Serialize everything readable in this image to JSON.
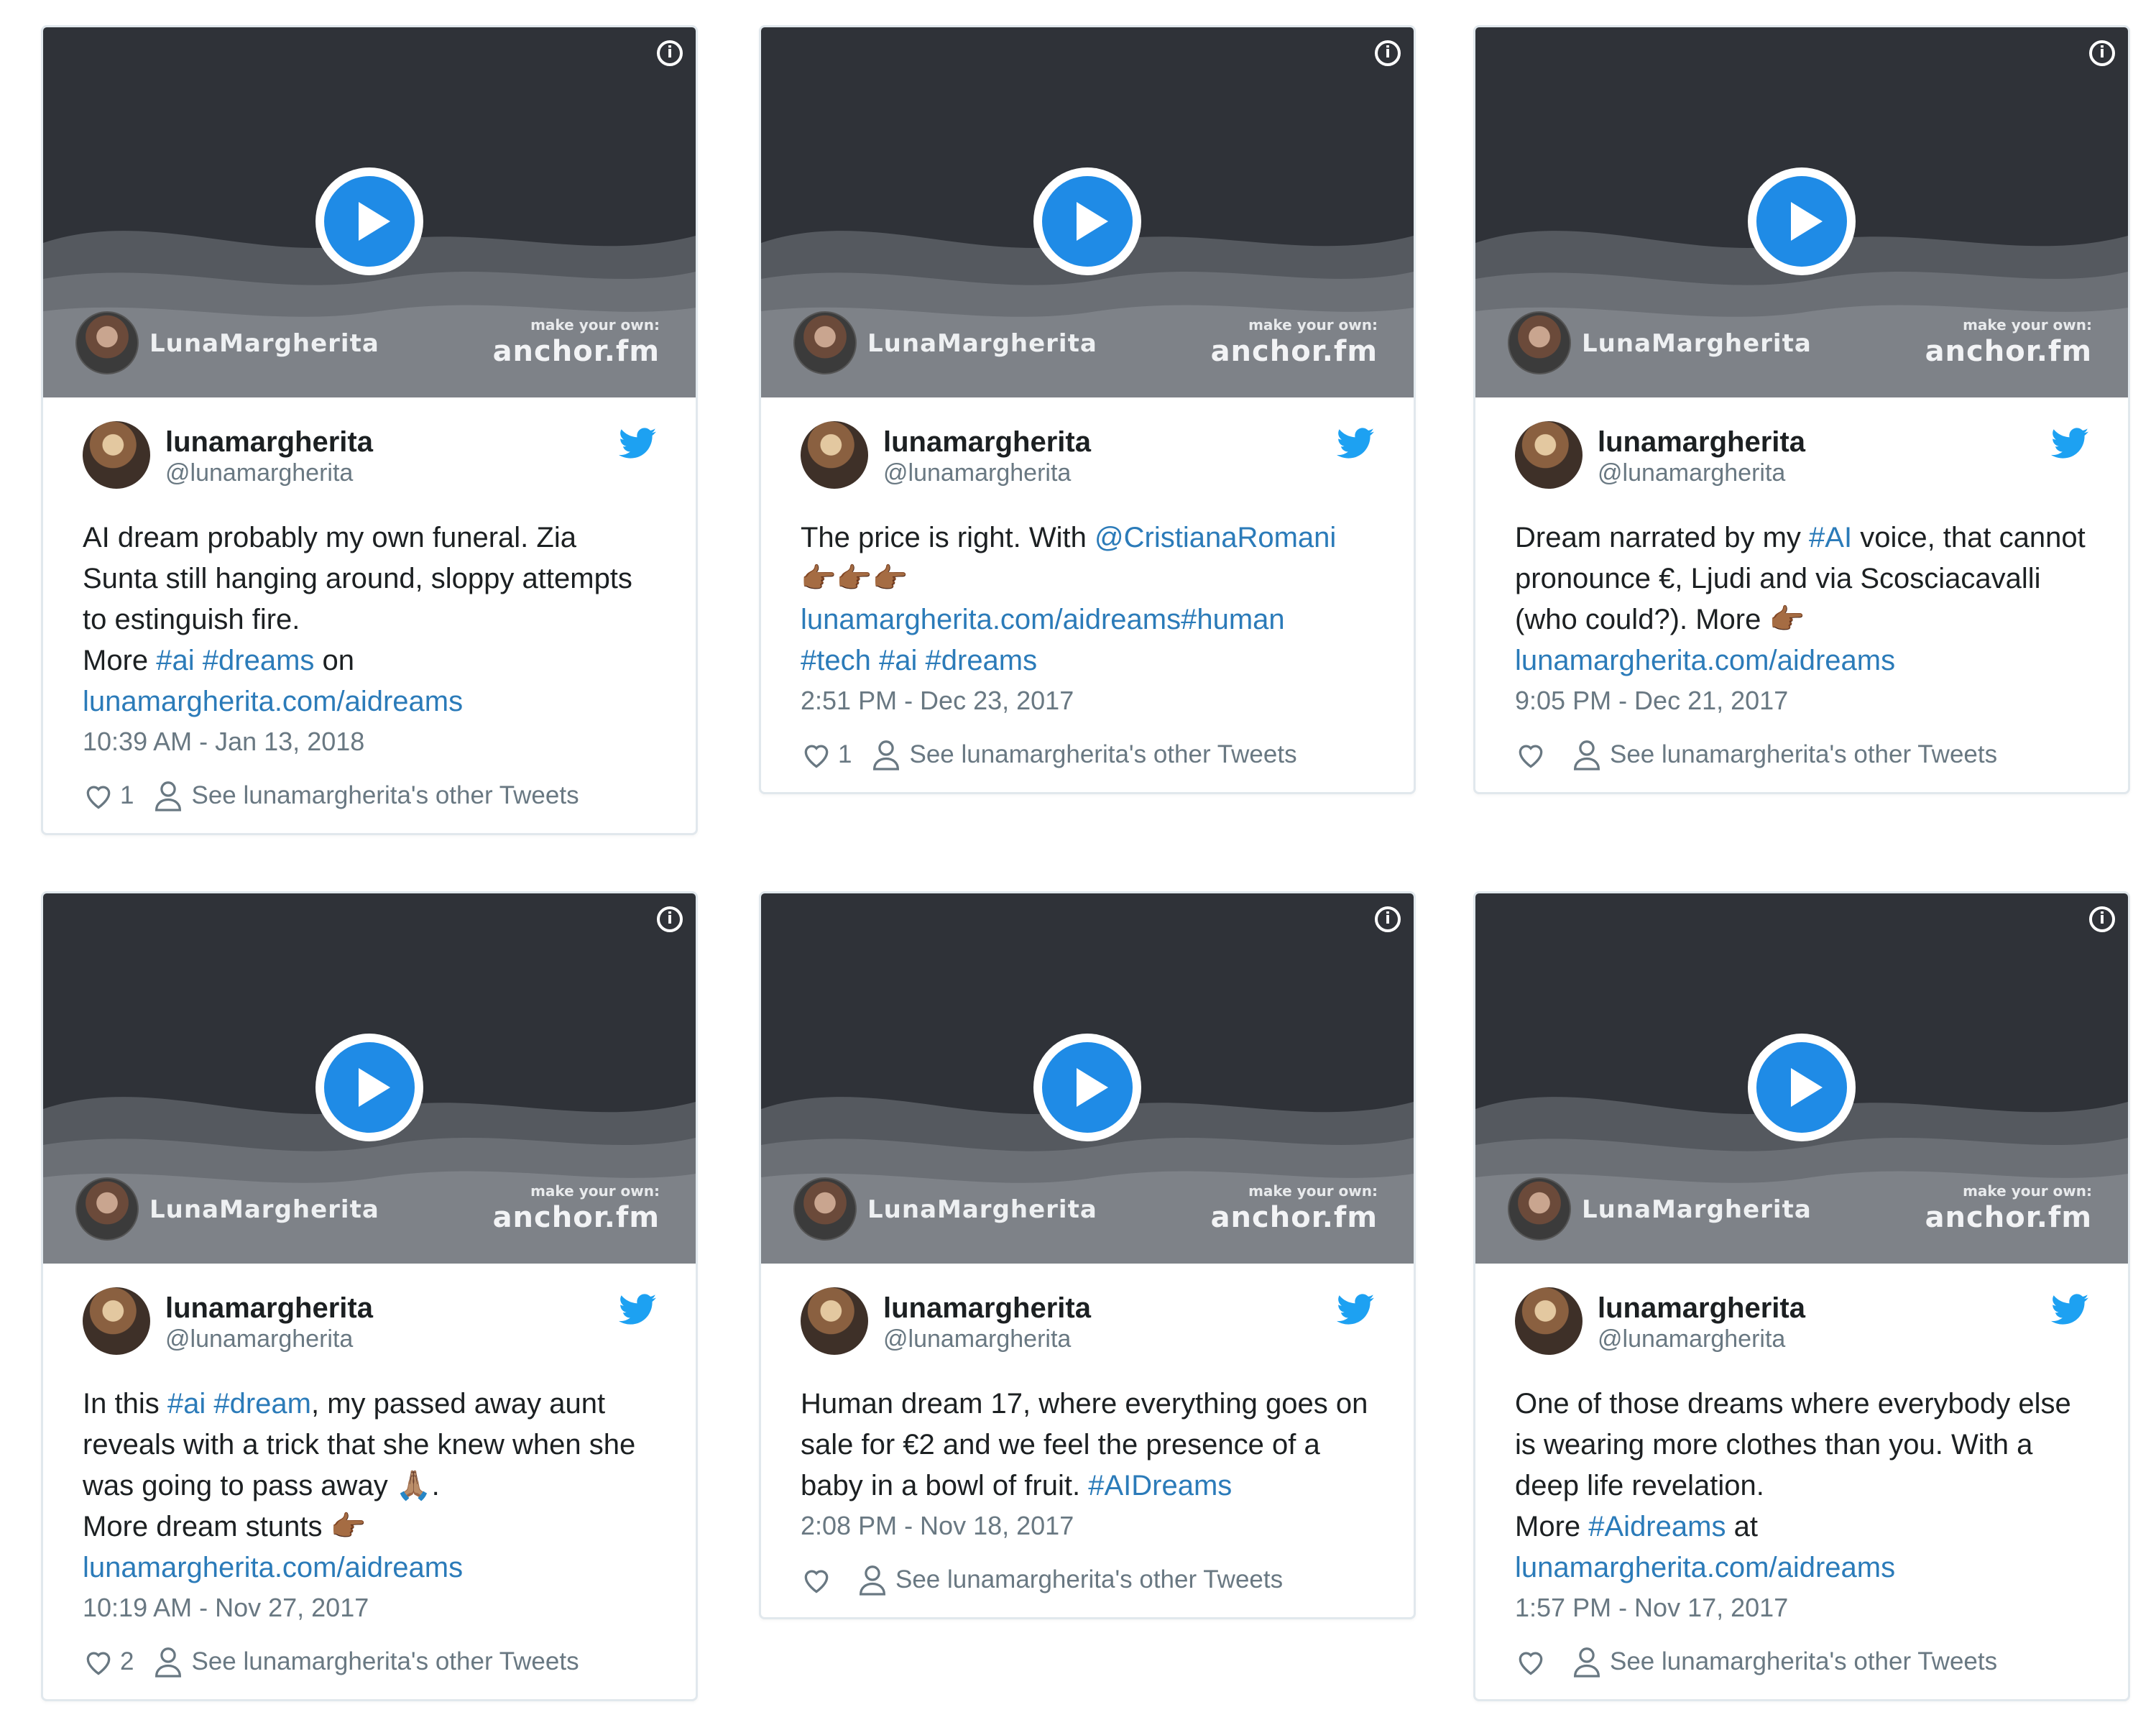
{
  "accent_color": "#2b7bb9",
  "play_color": "#1f8be6",
  "icons": {
    "info": "info-icon",
    "play": "play-icon",
    "twitter": "twitter-bird-icon",
    "heart": "heart-icon",
    "person": "person-icon",
    "point": "pointing-hand-emoji",
    "pray": "folded-hands-emoji"
  },
  "player": {
    "name": "LunaMargherita",
    "make_own": "make your own:",
    "anchor": "anchor.fm",
    "info": "i"
  },
  "tweets": [
    {
      "display_name": "lunamargherita",
      "handle": "@lunamargherita",
      "segments": [
        {
          "t": "AI dream probably my own funeral. Zia Sunta still hanging around, sloppy attempts to estinguish fire.\nMore "
        },
        {
          "t": "#ai",
          "link": true
        },
        {
          "t": " "
        },
        {
          "t": "#dreams",
          "link": true
        },
        {
          "t": " on\n"
        },
        {
          "t": "lunamargherita.com/aidreams",
          "link": true
        }
      ],
      "date": "10:39 AM - Jan 13, 2018",
      "likes": "1",
      "other": "See lunamargherita's other Tweets"
    },
    {
      "display_name": "lunamargherita",
      "handle": "@lunamargherita",
      "segments": [
        {
          "t": "The price is right. With "
        },
        {
          "t": "@CristianaRomani",
          "link": true
        },
        {
          "t": "\n👉🏾👉🏾👉🏾\n"
        },
        {
          "t": "lunamargherita.com/aidreams#human",
          "link": true
        },
        {
          "t": "\n"
        },
        {
          "t": "#tech",
          "link": true
        },
        {
          "t": " "
        },
        {
          "t": "#ai",
          "link": true
        },
        {
          "t": " "
        },
        {
          "t": "#dreams",
          "link": true
        }
      ],
      "date": "2:51 PM - Dec 23, 2017",
      "likes": "1",
      "other": "See lunamargherita's other Tweets"
    },
    {
      "display_name": "lunamargherita",
      "handle": "@lunamargherita",
      "segments": [
        {
          "t": "Dream narrated by my "
        },
        {
          "t": "#AI",
          "link": true
        },
        {
          "t": " voice, that cannot pronounce €, Ljudi and via Scosciacavalli (who could?). More 👉🏾\n"
        },
        {
          "t": "lunamargherita.com/aidreams",
          "link": true
        }
      ],
      "date": "9:05 PM - Dec 21, 2017",
      "likes": "",
      "other": "See lunamargherita's other Tweets"
    },
    {
      "display_name": "lunamargherita",
      "handle": "@lunamargherita",
      "segments": [
        {
          "t": "In this "
        },
        {
          "t": "#ai",
          "link": true
        },
        {
          "t": " "
        },
        {
          "t": "#dream",
          "link": true
        },
        {
          "t": ", my passed away aunt reveals with a trick that she knew when she was going to pass away 🙏🏽.\nMore dream stunts 👉🏾\n"
        },
        {
          "t": "lunamargherita.com/aidreams",
          "link": true
        }
      ],
      "date": "10:19 AM - Nov 27, 2017",
      "likes": "2",
      "other": "See lunamargherita's other Tweets"
    },
    {
      "display_name": "lunamargherita",
      "handle": "@lunamargherita",
      "segments": [
        {
          "t": "Human dream 17, where everything goes on sale for €2 and we feel the presence of a baby in a bowl of fruit. "
        },
        {
          "t": "#AIDreams",
          "link": true
        }
      ],
      "date": "2:08 PM - Nov 18, 2017",
      "likes": "",
      "other": "See lunamargherita's other Tweets"
    },
    {
      "display_name": "lunamargherita",
      "handle": "@lunamargherita",
      "segments": [
        {
          "t": "One of those dreams where everybody else is wearing more clothes than you. With a deep life revelation.\nMore "
        },
        {
          "t": "#Aidreams",
          "link": true
        },
        {
          "t": " at\n"
        },
        {
          "t": "lunamargherita.com/aidreams",
          "link": true
        }
      ],
      "date": "1:57 PM - Nov 17, 2017",
      "likes": "",
      "other": "See lunamargherita's other Tweets"
    }
  ]
}
